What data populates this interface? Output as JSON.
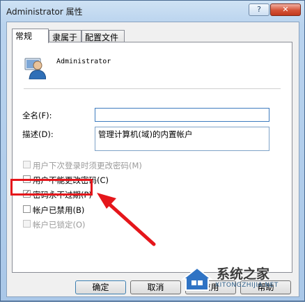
{
  "window": {
    "title": "Administrator 属性",
    "help_button": "?",
    "close_button": "✕"
  },
  "tabs": [
    {
      "label": "常规"
    },
    {
      "label": "隶属于"
    },
    {
      "label": "配置文件"
    }
  ],
  "user": {
    "name": "Administrator"
  },
  "fields": {
    "fullname_label": "全名(F):",
    "fullname_value": "",
    "description_label": "描述(D):",
    "description_value": "管理计算机(域)的内置帐户"
  },
  "checkboxes": [
    {
      "label": "用户下次登录时须更改密码(M)",
      "checked": false,
      "enabled": false
    },
    {
      "label": "用户不能更改密码(C)",
      "checked": false,
      "enabled": true
    },
    {
      "label": "密码永不过期(P)",
      "checked": true,
      "enabled": true
    },
    {
      "label": "帐户已禁用(B)",
      "checked": false,
      "enabled": true
    },
    {
      "label": "帐户已锁定(O)",
      "checked": false,
      "enabled": false
    }
  ],
  "buttons": {
    "ok": "确定",
    "cancel": "取消",
    "apply": "应用",
    "help": "帮助"
  },
  "annotation": {
    "highlight_color": "#e5161b"
  },
  "watermark": {
    "name": "系统之家",
    "url": "XITONGZHIJIA.NET"
  }
}
